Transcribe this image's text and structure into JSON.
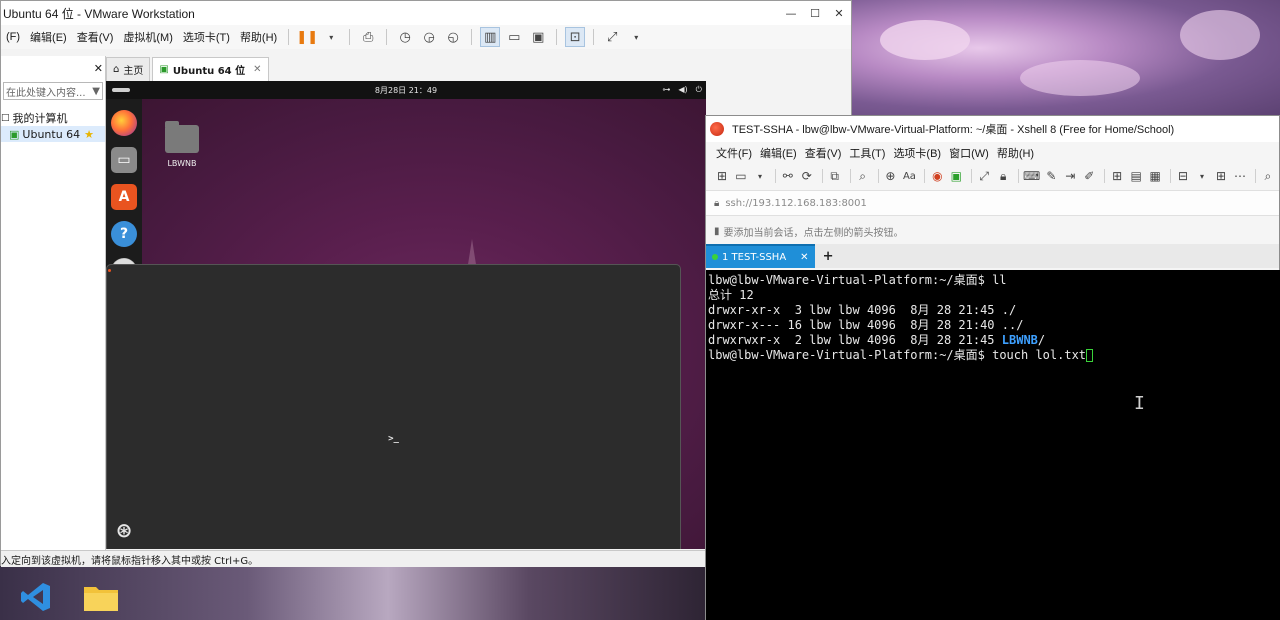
{
  "vmware": {
    "title": "Ubuntu 64 位 - VMware Workstation",
    "window_controls": {
      "minimize": "—",
      "maximize": "☐",
      "close": "✕"
    },
    "menu": [
      "(F)",
      "编辑(E)",
      "查看(V)",
      "虚拟机(M)",
      "选项卡(T)",
      "帮助(H)"
    ],
    "library": {
      "close": "✕",
      "search_placeholder": "在此处键入内容...",
      "tree": [
        {
          "label": "我的计算机"
        },
        {
          "label": "Ubuntu 64",
          "favorite": true
        }
      ]
    },
    "tabs": [
      {
        "label": "主页",
        "icon": "home-icon"
      },
      {
        "label": "Ubuntu 64 位",
        "icon": "vm-icon",
        "active": true,
        "close": "✕"
      }
    ],
    "status_text": "入定向到该虚拟机，请将鼠标指针移入其中或按 Ctrl+G。"
  },
  "ubuntu": {
    "clock": "8月28日  21：49",
    "language": "zh",
    "desktop_folder": "LBWNB",
    "dock_apps": [
      "firefox",
      "files",
      "app-center",
      "help",
      "terminal",
      "disc",
      "trash",
      "show-apps"
    ]
  },
  "xshell": {
    "title": "TEST-SSHA - lbw@lbw-VMware-Virtual-Platform: ~/桌面 - Xshell 8 (Free for Home/School)",
    "menu": [
      "文件(F)",
      "编辑(E)",
      "查看(V)",
      "工具(T)",
      "选项卡(B)",
      "窗口(W)",
      "帮助(H)"
    ],
    "address": "ssh://193.112.168.183:8001",
    "hint": "要添加当前会话，点击左侧的箭头按钮。",
    "tab_label": "1 TEST-SSHA",
    "tab_close": "✕",
    "add_tab": "+",
    "terminal": {
      "lines": [
        "lbw@lbw-VMware-Virtual-Platform:~/桌面$ ll",
        "总计 12",
        "drwxr-xr-x  3 lbw lbw 4096  8月 28 21:45 ./",
        "drwxr-x--- 16 lbw lbw 4096  8月 28 21:40 ../",
        "drwxrwxr-x  2 lbw lbw 4096  8月 28 21:45 "
      ],
      "dir_highlight": "LBWNB",
      "dir_suffix": "/",
      "prompt": "lbw@lbw-VMware-Virtual-Platform:~/桌面$ ",
      "command": "touch lol.txt"
    }
  },
  "colors": {
    "accent_blue": "#1f8fd8",
    "ubuntu_orange": "#e95420",
    "terminal_bg": "#000000",
    "dir_blue": "#3ea0ff"
  }
}
